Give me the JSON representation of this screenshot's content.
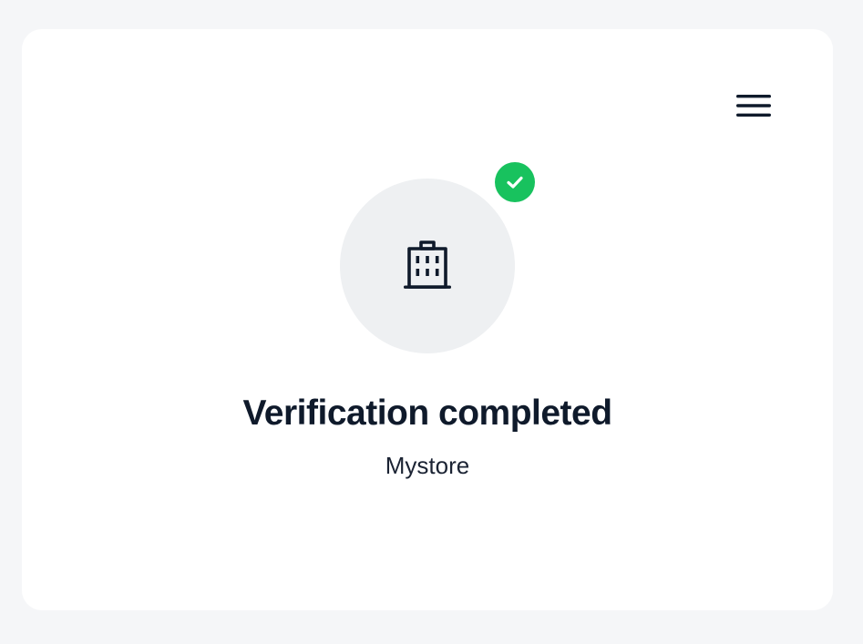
{
  "header": {
    "menu_icon": "hamburger-menu-icon"
  },
  "verification": {
    "icon": "building-icon",
    "badge_icon": "checkmark-icon",
    "badge_color": "#18c25e",
    "title": "Verification completed",
    "store_name": "Mystore"
  },
  "colors": {
    "page_background": "#f5f6f8",
    "card_background": "#ffffff",
    "avatar_background": "#eef0f2",
    "text_primary": "#0f1a2b"
  }
}
